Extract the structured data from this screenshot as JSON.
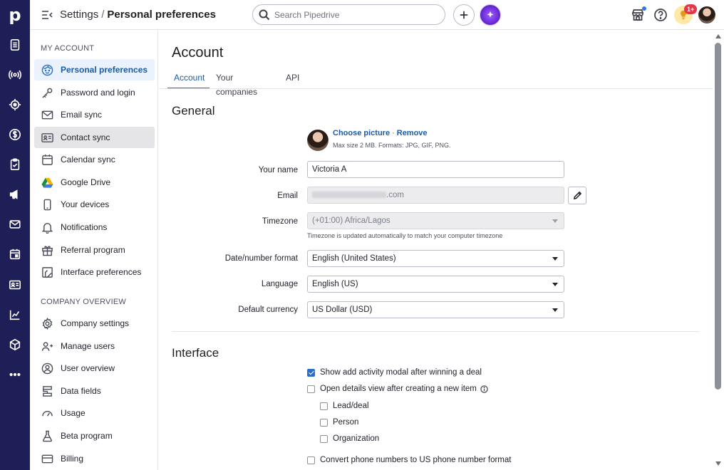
{
  "app": {
    "logo": "p"
  },
  "topbar": {
    "breadcrumb_root": "Settings",
    "breadcrumb_sep": "/",
    "breadcrumb_current": "Personal preferences",
    "search_placeholder": "Search Pipedrive",
    "tips_badge": "1+"
  },
  "rail": {
    "icons": [
      "deals-icon",
      "leads-icon",
      "target-icon",
      "dollar-icon",
      "activities-icon",
      "campaigns-icon",
      "mail-icon",
      "calendar-icon",
      "contacts-icon",
      "insights-icon",
      "products-icon",
      "more-icon"
    ]
  },
  "sidebar": {
    "my_account_title": "MY ACCOUNT",
    "my_account_items": [
      {
        "label": "Personal preferences",
        "icon": "face-icon"
      },
      {
        "label": "Password and login",
        "icon": "key-icon"
      },
      {
        "label": "Email sync",
        "icon": "envelope-icon"
      },
      {
        "label": "Contact sync",
        "icon": "contact-card-icon"
      },
      {
        "label": "Calendar sync",
        "icon": "calendar-icon"
      },
      {
        "label": "Google Drive",
        "icon": "google-drive-icon"
      },
      {
        "label": "Your devices",
        "icon": "phone-icon"
      },
      {
        "label": "Notifications",
        "icon": "bell-icon"
      },
      {
        "label": "Referral program",
        "icon": "gift-icon"
      },
      {
        "label": "Interface preferences",
        "icon": "interface-icon"
      }
    ],
    "company_title": "COMPANY OVERVIEW",
    "company_items": [
      {
        "label": "Company settings",
        "icon": "gear-icon"
      },
      {
        "label": "Manage users",
        "icon": "users-icon"
      },
      {
        "label": "User overview",
        "icon": "user-circle-icon"
      },
      {
        "label": "Data fields",
        "icon": "data-fields-icon"
      },
      {
        "label": "Usage",
        "icon": "gauge-icon"
      },
      {
        "label": "Beta program",
        "icon": "flask-icon"
      },
      {
        "label": "Billing",
        "icon": "credit-card-icon"
      }
    ]
  },
  "main": {
    "title": "Account",
    "tabs": [
      "Account",
      "Your companies",
      "API"
    ],
    "general_title": "General",
    "picture": {
      "choose": "Choose picture",
      "dot": "·",
      "remove": "Remove",
      "hint": "Max size 2 MB. Formats: JPG, GIF, PNG."
    },
    "fields": {
      "name_label": "Your name",
      "name_value": "Victoria A",
      "email_label": "Email",
      "email_value": ".com",
      "timezone_label": "Timezone",
      "timezone_value": "(+01:00) Africa/Lagos",
      "timezone_hint": "Timezone is updated automatically to match your computer timezone",
      "date_label": "Date/number format",
      "date_value": "English (United States)",
      "language_label": "Language",
      "language_value": "English (US)",
      "currency_label": "Default currency",
      "currency_value": "US Dollar (USD)"
    },
    "interface_title": "Interface",
    "checkboxes": [
      {
        "label": "Show add activity modal after winning a deal",
        "checked": true
      },
      {
        "label": "Open details view after creating a new item",
        "checked": false
      },
      {
        "label": "Lead/deal",
        "checked": false
      },
      {
        "label": "Person",
        "checked": false
      },
      {
        "label": "Organization",
        "checked": false
      },
      {
        "label": "Convert phone numbers to US phone number format",
        "checked": false
      }
    ]
  }
}
